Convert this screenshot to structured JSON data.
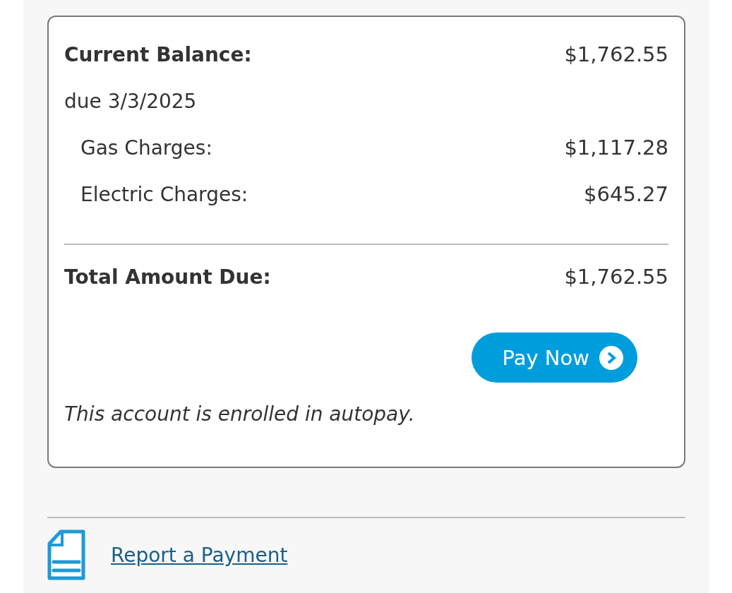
{
  "balance_card": {
    "rows": [
      {
        "kind": "header",
        "label": "Current Balance:",
        "amount": "$1,762.55"
      },
      {
        "kind": "note",
        "label": "due 3/3/2025"
      },
      {
        "kind": "sub",
        "label": "Gas Charges:",
        "amount": "$1,117.28"
      },
      {
        "kind": "sub",
        "label": "Electric Charges:",
        "amount": "$645.27"
      }
    ],
    "total": {
      "label": "Total Amount Due:",
      "amount": "$1,762.55"
    },
    "pay_button": {
      "label": "Pay Now"
    },
    "autopay_note": "This account is enrolled in autopay."
  },
  "report_link": {
    "label": "Report a Payment"
  }
}
